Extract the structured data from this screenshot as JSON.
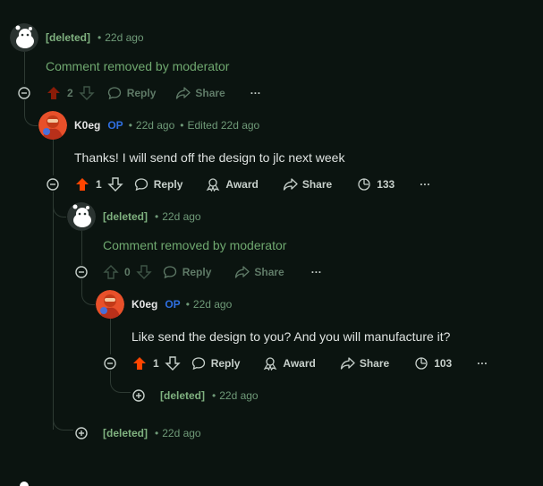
{
  "comments": [
    {
      "author": "[deleted]",
      "time": "22d ago",
      "body": "Comment removed by moderator",
      "score": "2",
      "reply": "Reply",
      "share": "Share",
      "more": "···"
    },
    {
      "author": "K0eg",
      "op": "OP",
      "time": "22d ago",
      "edited": "Edited 22d ago",
      "body": "Thanks! I will send off the design to jlc next week",
      "score": "1",
      "reply": "Reply",
      "award": "Award",
      "share": "Share",
      "insights": "133",
      "more": "···"
    },
    {
      "author": "[deleted]",
      "time": "22d ago",
      "body": "Comment removed by moderator",
      "score": "0",
      "reply": "Reply",
      "share": "Share",
      "more": "···"
    },
    {
      "author": "K0eg",
      "op": "OP",
      "time": "22d ago",
      "body": "Like send the design to you? And you will manufacture it?",
      "score": "1",
      "reply": "Reply",
      "award": "Award",
      "share": "Share",
      "insights": "103",
      "more": "···"
    },
    {
      "author": "[deleted]",
      "time": "22d ago",
      "collapsed": true
    },
    {
      "author": "[deleted]",
      "time": "22d ago",
      "collapsed": true
    }
  ],
  "colors": {
    "background": "#0b1410",
    "upvote": "#ff4500",
    "op_badge": "#2f6fe0",
    "removed_text": "#6fa86f",
    "deleted_author": "#7fb17f"
  },
  "icons": [
    "snoo-avatar-icon",
    "user-avatar-icon",
    "upvote-icon",
    "downvote-icon",
    "reply-icon",
    "award-icon",
    "share-icon",
    "insights-icon",
    "collapse-icon",
    "expand-icon",
    "more-icon"
  ]
}
